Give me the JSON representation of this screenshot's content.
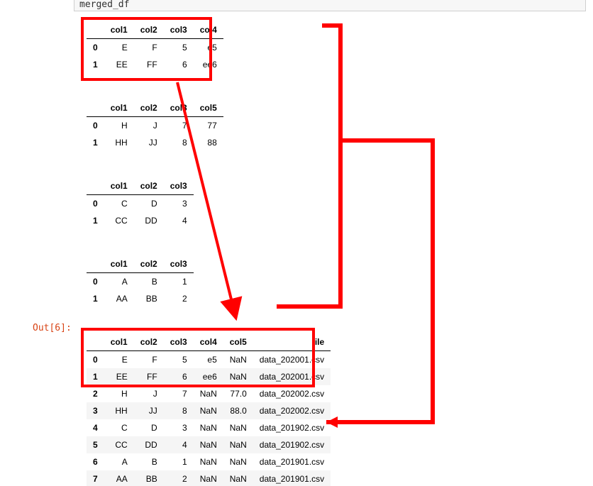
{
  "cell_code": "merged_df",
  "out_label": "Out[6]:",
  "table1": {
    "headers": [
      "",
      "col1",
      "col2",
      "col3",
      "col4"
    ],
    "rows": [
      {
        "idx": "0",
        "cells": [
          "E",
          "F",
          "5",
          "e5"
        ]
      },
      {
        "idx": "1",
        "cells": [
          "EE",
          "FF",
          "6",
          "ee6"
        ]
      }
    ]
  },
  "table2": {
    "headers": [
      "",
      "col1",
      "col2",
      "col3",
      "col5"
    ],
    "rows": [
      {
        "idx": "0",
        "cells": [
          "H",
          "J",
          "7",
          "77"
        ]
      },
      {
        "idx": "1",
        "cells": [
          "HH",
          "JJ",
          "8",
          "88"
        ]
      }
    ]
  },
  "table3": {
    "headers": [
      "",
      "col1",
      "col2",
      "col3"
    ],
    "rows": [
      {
        "idx": "0",
        "cells": [
          "C",
          "D",
          "3"
        ]
      },
      {
        "idx": "1",
        "cells": [
          "CC",
          "DD",
          "4"
        ]
      }
    ]
  },
  "table4": {
    "headers": [
      "",
      "col1",
      "col2",
      "col3"
    ],
    "rows": [
      {
        "idx": "0",
        "cells": [
          "A",
          "B",
          "1"
        ]
      },
      {
        "idx": "1",
        "cells": [
          "AA",
          "BB",
          "2"
        ]
      }
    ]
  },
  "table5": {
    "headers": [
      "",
      "col1",
      "col2",
      "col3",
      "col4",
      "col5",
      "file"
    ],
    "rows": [
      {
        "idx": "0",
        "cells": [
          "E",
          "F",
          "5",
          "e5",
          "NaN",
          "data_202001.csv"
        ]
      },
      {
        "idx": "1",
        "cells": [
          "EE",
          "FF",
          "6",
          "ee6",
          "NaN",
          "data_202001.csv"
        ]
      },
      {
        "idx": "2",
        "cells": [
          "H",
          "J",
          "7",
          "NaN",
          "77.0",
          "data_202002.csv"
        ]
      },
      {
        "idx": "3",
        "cells": [
          "HH",
          "JJ",
          "8",
          "NaN",
          "88.0",
          "data_202002.csv"
        ]
      },
      {
        "idx": "4",
        "cells": [
          "C",
          "D",
          "3",
          "NaN",
          "NaN",
          "data_201902.csv"
        ]
      },
      {
        "idx": "5",
        "cells": [
          "CC",
          "DD",
          "4",
          "NaN",
          "NaN",
          "data_201902.csv"
        ]
      },
      {
        "idx": "6",
        "cells": [
          "A",
          "B",
          "1",
          "NaN",
          "NaN",
          "data_201901.csv"
        ]
      },
      {
        "idx": "7",
        "cells": [
          "AA",
          "BB",
          "2",
          "NaN",
          "NaN",
          "data_201901.csv"
        ]
      }
    ]
  }
}
